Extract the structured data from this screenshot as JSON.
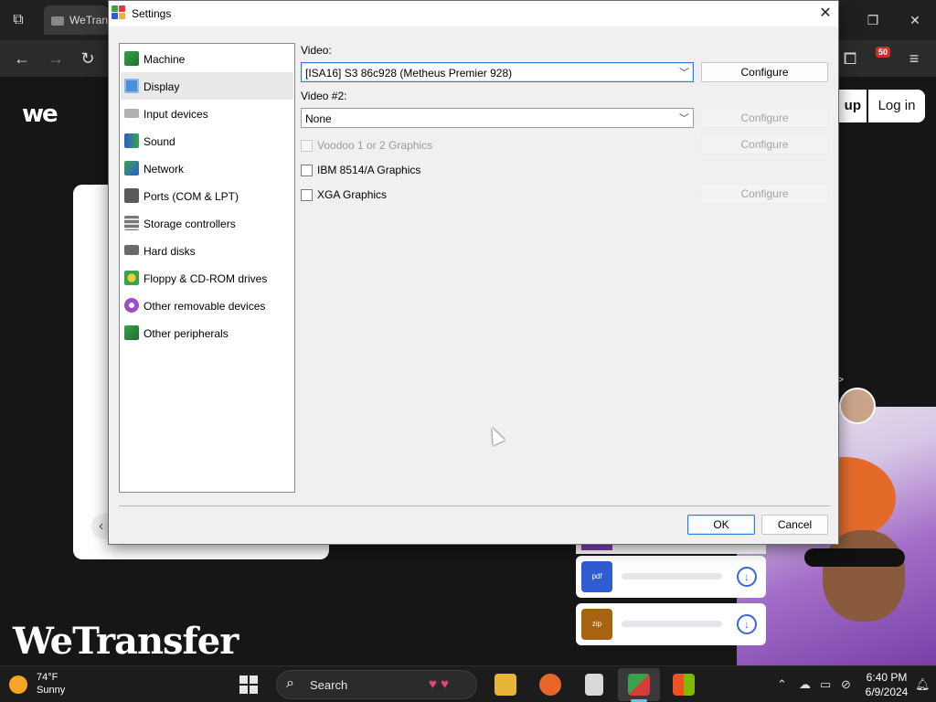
{
  "browser": {
    "tab_title": "WeTran",
    "window_controls": {
      "minimize_icon": "minimize-icon",
      "restore_icon": "restore-icon",
      "close_icon": "close-icon"
    },
    "nav_icons": [
      "back-icon",
      "forward-icon",
      "reload-icon"
    ],
    "extension_badge": "50"
  },
  "website": {
    "header_logo": "we",
    "signup_label": "up",
    "login_label": "Log in",
    "brand_wordmark": "WeTransfer",
    "file_cards": [
      {
        "type_label": "pdf",
        "color": "#2f5bd3"
      },
      {
        "type_label": "zip",
        "color": "#a8630f"
      }
    ]
  },
  "dialog": {
    "title": "Settings",
    "categories": [
      {
        "label": "Machine",
        "icon": "motherboard-icon",
        "selected": false
      },
      {
        "label": "Display",
        "icon": "display-icon",
        "selected": true
      },
      {
        "label": "Input devices",
        "icon": "keyboard-icon",
        "selected": false
      },
      {
        "label": "Sound",
        "icon": "speaker-icon",
        "selected": false
      },
      {
        "label": "Network",
        "icon": "network-icon",
        "selected": false
      },
      {
        "label": "Ports (COM & LPT)",
        "icon": "ports-icon",
        "selected": false
      },
      {
        "label": "Storage controllers",
        "icon": "storage-icon",
        "selected": false
      },
      {
        "label": "Hard disks",
        "icon": "hard-disk-icon",
        "selected": false
      },
      {
        "label": "Floppy & CD-ROM drives",
        "icon": "floppy-icon",
        "selected": false
      },
      {
        "label": "Other removable devices",
        "icon": "removable-icon",
        "selected": false
      },
      {
        "label": "Other peripherals",
        "icon": "peripheral-icon",
        "selected": false
      }
    ],
    "video_label": "Video:",
    "video_value": "[ISA16] S3 86c928 (Metheus Premier 928)",
    "video2_label": "Video #2:",
    "video2_value": "None",
    "configure_label": "Configure",
    "options": [
      {
        "label": "Voodoo 1 or 2 Graphics",
        "checked": false,
        "enabled": false
      },
      {
        "label": "IBM 8514/A Graphics",
        "checked": false,
        "enabled": true
      },
      {
        "label": "XGA Graphics",
        "checked": false,
        "enabled": true
      }
    ],
    "ok_label": "OK",
    "cancel_label": "Cancel"
  },
  "taskbar": {
    "weather_temp": "74°F",
    "weather_condition": "Sunny",
    "search_placeholder": "Search",
    "time": "6:40 PM",
    "date": "6/9/2024",
    "accent_color": "#76b9ed"
  }
}
